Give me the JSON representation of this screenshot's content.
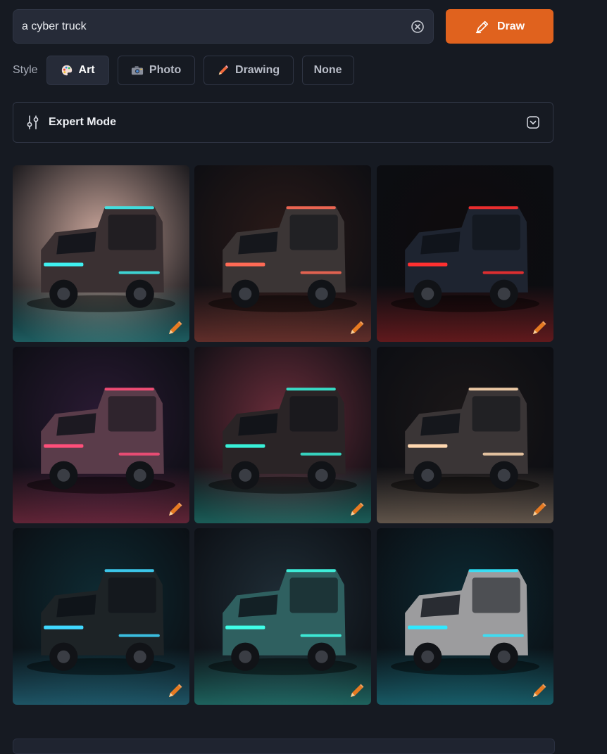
{
  "search": {
    "value": "a cyber truck",
    "clear_icon": "close-circle-icon"
  },
  "draw_button": {
    "label": "Draw",
    "icon": "pencil-icon"
  },
  "style": {
    "label": "Style",
    "options": [
      {
        "label": "Art",
        "icon": "palette-icon",
        "active": true
      },
      {
        "label": "Photo",
        "icon": "camera-icon",
        "active": false
      },
      {
        "label": "Drawing",
        "icon": "pencil-icon",
        "active": false
      },
      {
        "label": "None",
        "icon": "",
        "active": false
      }
    ]
  },
  "expert_mode": {
    "label": "Expert Mode",
    "icon": "sliders-icon",
    "toggle_icon": "chevron-down-icon"
  },
  "results": [
    {
      "name": "cyber-truck-result-1",
      "palette": [
        "#c9a59a",
        "#3a3032",
        "#3ff0f0"
      ]
    },
    {
      "name": "cyber-truck-result-2",
      "palette": [
        "#2a1a18",
        "#3b3535",
        "#ff6a55"
      ]
    },
    {
      "name": "cyber-truck-result-3",
      "palette": [
        "#0f0c0d",
        "#1e2430",
        "#ff3030"
      ]
    },
    {
      "name": "cyber-truck-result-4",
      "palette": [
        "#2a1a33",
        "#5a3c4a",
        "#ff4f7a"
      ]
    },
    {
      "name": "cyber-truck-result-5",
      "palette": [
        "#6a2d3a",
        "#2a2426",
        "#38f0d8"
      ]
    },
    {
      "name": "cyber-truck-result-6",
      "palette": [
        "#1b1718",
        "#3a3536",
        "#ffd8b0"
      ]
    },
    {
      "name": "cyber-truck-result-7",
      "palette": [
        "#0e2b33",
        "#1d2326",
        "#40d8ff"
      ]
    },
    {
      "name": "cyber-truck-result-8",
      "palette": [
        "#1f2d36",
        "#2f6060",
        "#40ffe8"
      ]
    },
    {
      "name": "cyber-truck-result-9",
      "palette": [
        "#0c2a33",
        "#9c9c9e",
        "#2fe8ff"
      ]
    }
  ],
  "colors": {
    "accent": "#e0621e",
    "background": "#161a22",
    "panel": "#262b38",
    "edit_icon": "#e67a22"
  }
}
